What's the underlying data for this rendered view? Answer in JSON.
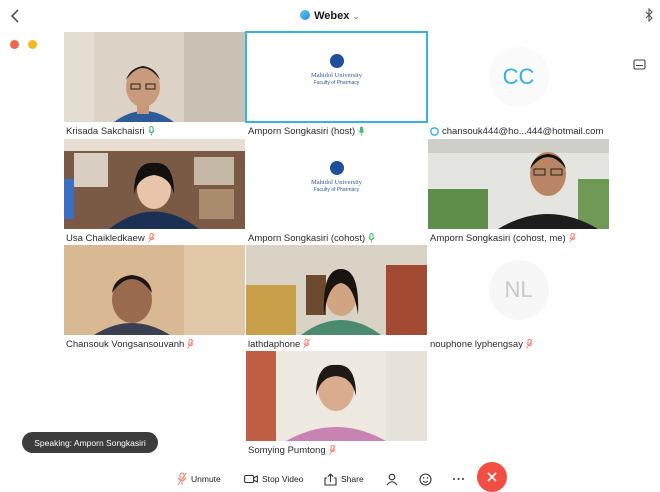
{
  "header": {
    "app_title": "Webex"
  },
  "participants": [
    {
      "name": "Krisada Sakchaisri",
      "mic": "green",
      "kind": "video"
    },
    {
      "name": "Amporn Songkasiri (host)",
      "mic": "green",
      "kind": "logo"
    },
    {
      "name": "chansouk444@ho...444@hotmail.com",
      "mic": "none",
      "kind": "initials",
      "initials": "CC"
    },
    {
      "name": "Usa Chaikledkaew",
      "mic": "muted",
      "kind": "video"
    },
    {
      "name": "Amporn Songkasiri (cohost)",
      "mic": "green",
      "kind": "logo"
    },
    {
      "name": "Amporn Songkasiri (cohost, me)",
      "mic": "muted",
      "kind": "video"
    },
    {
      "name": "Chansouk Vongsansouvanh",
      "mic": "muted",
      "kind": "video"
    },
    {
      "name": "lathdaphone",
      "mic": "muted",
      "kind": "video"
    },
    {
      "name": "nouphone lyphengsay",
      "mic": "muted",
      "kind": "initials",
      "initials": "NL"
    },
    {
      "name": "Somying Pumtong",
      "mic": "muted",
      "kind": "video"
    }
  ],
  "mahidol_logo": {
    "line1": "Mahidol University",
    "line2": "Faculty of Pharmacy"
  },
  "speaking": {
    "label": "Speaking: Amporn Songkasiri"
  },
  "toolbar": {
    "unmute": "Unmute",
    "stop_video": "Stop Video",
    "share": "Share"
  },
  "colors": {
    "accent": "#36b3e0",
    "muted_mic": "#f28a7c",
    "active_mic": "#46c06b",
    "end_call": "#f24f44",
    "initials_cc": "#2fb2e6",
    "initials_nl": "#c9c9c9"
  }
}
